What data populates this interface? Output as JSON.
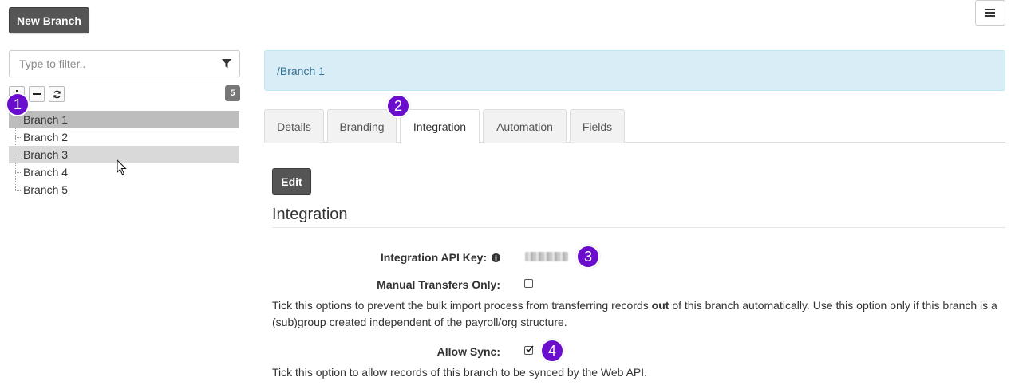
{
  "header": {
    "new_branch_label": "New Branch",
    "menu_icon": "hamburger-icon"
  },
  "filter": {
    "placeholder": "Type to filter..",
    "icon": "filter-icon"
  },
  "tree_toolbar": {
    "expand_icon": "plus-icon",
    "collapse_icon": "minus-icon",
    "refresh_icon": "refresh-icon",
    "count": "5"
  },
  "tree": {
    "items": [
      {
        "label": "Branch 1",
        "state": "selected"
      },
      {
        "label": "Branch 2",
        "state": "normal"
      },
      {
        "label": "Branch 3",
        "state": "hover"
      },
      {
        "label": "Branch 4",
        "state": "normal"
      },
      {
        "label": "Branch 5",
        "state": "normal"
      }
    ]
  },
  "breadcrumb": "/Branch 1",
  "tabs": [
    {
      "label": "Details",
      "active": false
    },
    {
      "label": "Branding",
      "active": false
    },
    {
      "label": "Integration",
      "active": true
    },
    {
      "label": "Automation",
      "active": false
    },
    {
      "label": "Fields",
      "active": false
    }
  ],
  "content": {
    "edit_label": "Edit",
    "section_title": "Integration",
    "api_key_label": "Integration API Key:",
    "api_key_info_icon": "info-circle-icon",
    "manual_transfers_label": "Manual Transfers Only:",
    "manual_transfers_checked": false,
    "manual_help_before": "Tick this options to prevent the bulk import process from transferring records ",
    "manual_help_bold": "out",
    "manual_help_after": " of this branch automatically. Use this option only if this branch is a (sub)group created independent of the payroll/org structure.",
    "allow_sync_label": "Allow Sync:",
    "allow_sync_checked": true,
    "allow_sync_help": "Tick this option to allow records of this branch to be synced by the Web API."
  },
  "markers": [
    "1",
    "2",
    "3",
    "4"
  ],
  "colors": {
    "marker": "#6a0dcc",
    "breadcrumb_bg": "#d9edf7",
    "breadcrumb_text": "#31708f",
    "dark_button": "#555555",
    "selected_row": "#bdbdbd"
  }
}
